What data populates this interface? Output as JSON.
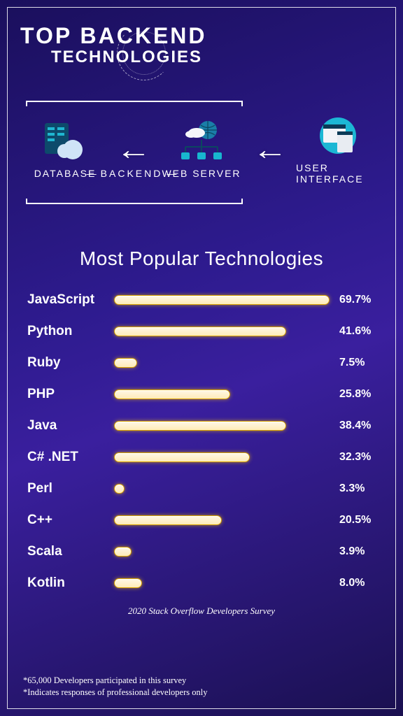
{
  "header": {
    "line1": "TOP BACKEND",
    "line2": "TECHNOLOGIES"
  },
  "diagram": {
    "nodes": [
      {
        "label": "DATABASE"
      },
      {
        "label": "WEB SERVER"
      },
      {
        "label": "USER INTERFACE"
      }
    ],
    "bracket_label": "BACKEND"
  },
  "chart_title": "Most Popular Technologies",
  "chart_data": {
    "type": "bar",
    "title": "Most Popular Technologies",
    "xlabel": "",
    "ylabel": "",
    "ylim": [
      0,
      100
    ],
    "categories": [
      "JavaScript",
      "Python",
      "Ruby",
      "PHP",
      "Java",
      "C# .NET",
      "Perl",
      "C++",
      "Scala",
      "Kotlin"
    ],
    "values": [
      69.7,
      41.6,
      7.5,
      25.8,
      38.4,
      32.3,
      3.3,
      20.5,
      3.9,
      8.0
    ],
    "value_labels": [
      "69.7%",
      "41.6%",
      "7.5%",
      "25.8%",
      "38.4%",
      "32.3%",
      "3.3%",
      "20.5%",
      "3.9%",
      "8.0%"
    ]
  },
  "source": "2020 Stack Overflow Developers Survey",
  "footnotes": [
    "*65,000 Developers participated in this survey",
    "*Indicates responses of professional developers only"
  ]
}
